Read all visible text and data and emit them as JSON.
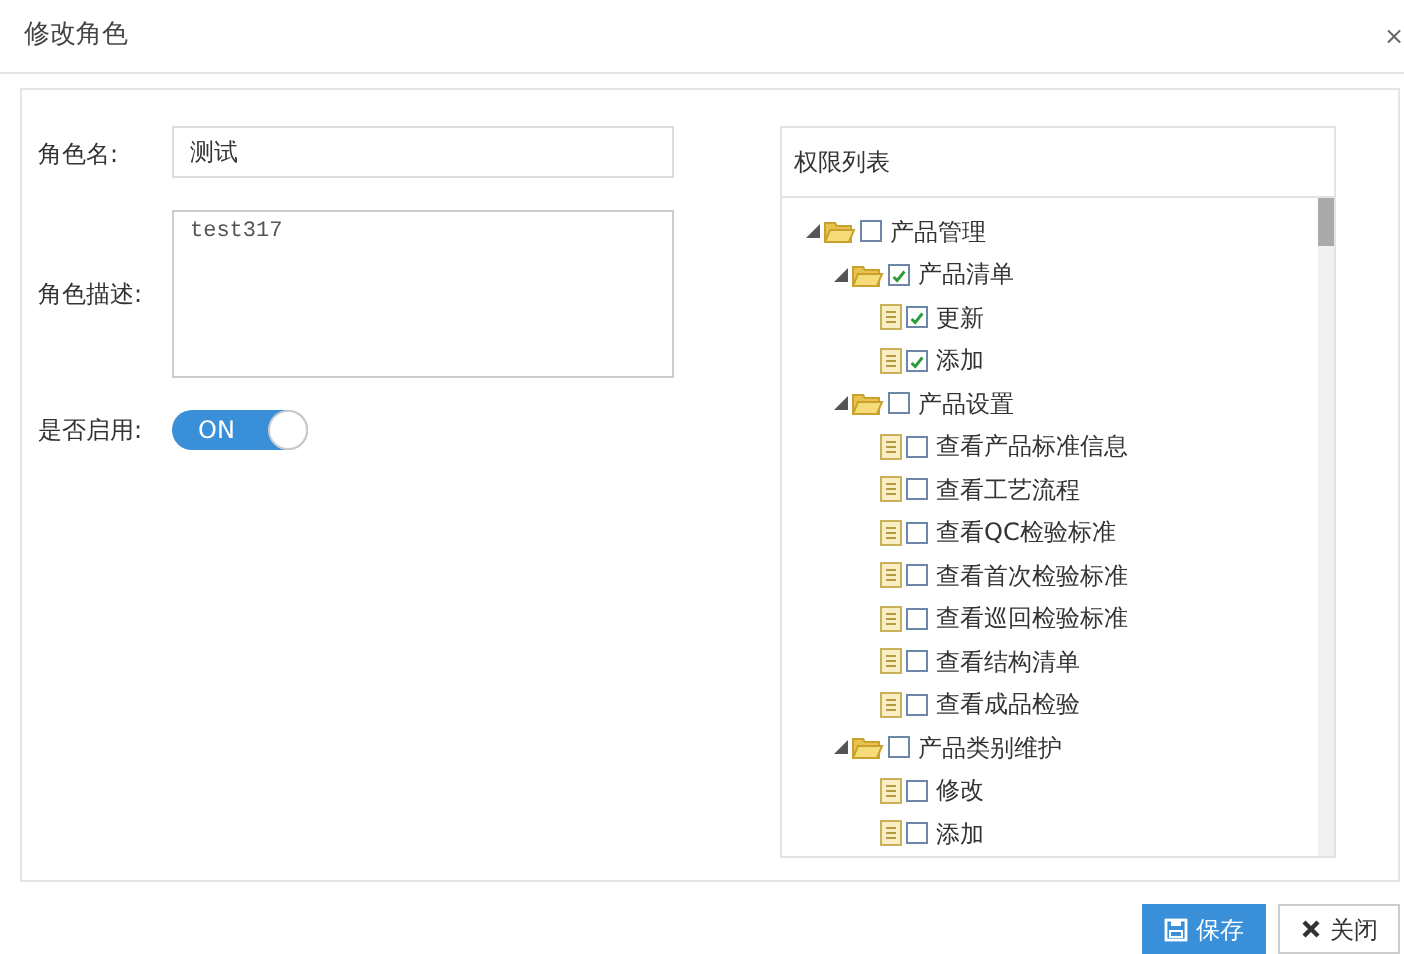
{
  "dialog": {
    "title": "修改角色",
    "close": "×"
  },
  "form": {
    "name_label": "角色名:",
    "name_value": "测试",
    "desc_label": "角色描述:",
    "desc_value": "test317",
    "enabled_label": "是否启用:",
    "enabled": {
      "on": true,
      "label": "ON"
    }
  },
  "permissions": {
    "title": "权限列表",
    "tree": [
      {
        "label": "产品管理",
        "checked": false,
        "expanded": true,
        "children": [
          {
            "label": "产品清单",
            "checked": true,
            "expanded": true,
            "children": [
              {
                "label": "更新",
                "checked": true
              },
              {
                "label": "添加",
                "checked": true
              }
            ]
          },
          {
            "label": "产品设置",
            "checked": false,
            "expanded": true,
            "children": [
              {
                "label": "查看产品标准信息",
                "checked": false
              },
              {
                "label": "查看工艺流程",
                "checked": false
              },
              {
                "label": "查看QC检验标准",
                "checked": false
              },
              {
                "label": "查看首次检验标准",
                "checked": false
              },
              {
                "label": "查看巡回检验标准",
                "checked": false
              },
              {
                "label": "查看结构清单",
                "checked": false
              },
              {
                "label": "查看成品检验",
                "checked": false
              }
            ]
          },
          {
            "label": "产品类别维护",
            "checked": false,
            "expanded": true,
            "children": [
              {
                "label": "修改",
                "checked": false
              },
              {
                "label": "添加",
                "checked": false
              }
            ]
          }
        ]
      }
    ]
  },
  "buttons": [
    {
      "kind": "save",
      "label": "保存"
    },
    {
      "kind": "close",
      "label": "关闭"
    }
  ]
}
